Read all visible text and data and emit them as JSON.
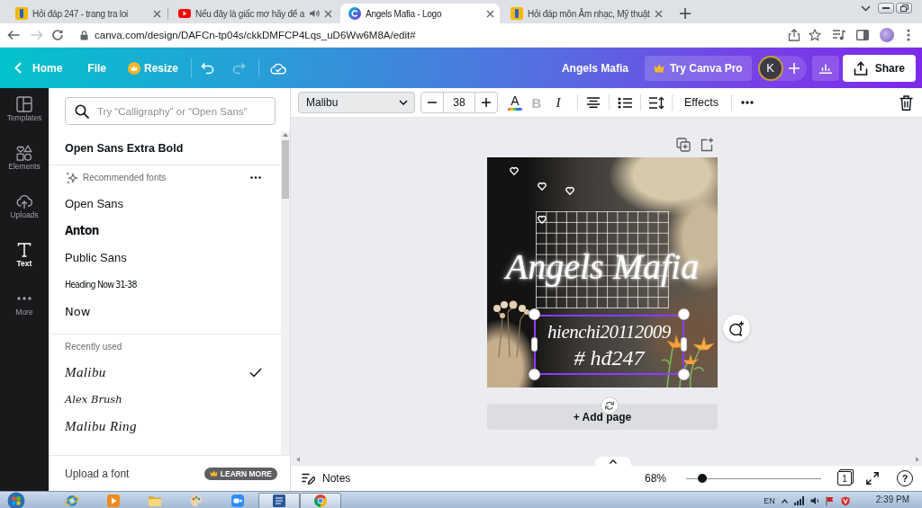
{
  "browser": {
    "tabs": [
      {
        "kind": "hoidap",
        "title": "Hỏi đáp 247 - trang tra loi",
        "audio": false,
        "selected": false
      },
      {
        "kind": "youtube",
        "title": "Nếu đây là giấc mơ hãy để a",
        "audio": true,
        "selected": false
      },
      {
        "kind": "canva",
        "title": "Angels Mafia - Logo",
        "audio": false,
        "selected": true
      },
      {
        "kind": "hoidap",
        "title": "Hỏi đáp môn Âm nhạc, Mỹ thuật",
        "audio": false,
        "selected": false
      }
    ],
    "nav": [
      {
        "kind": "back",
        "disabled": false
      },
      {
        "kind": "forward",
        "disabled": true
      }
    ],
    "url": "canva.com/design/DAFCn-tp04s/ckkDMFCP4Lqs_uD6Ww6M8A/edit#"
  },
  "header": {
    "home": "Home",
    "file": "File",
    "resize": "Resize",
    "history": [
      {
        "kind": "undo",
        "disabled": false
      },
      {
        "kind": "redo",
        "disabled": true
      }
    ],
    "design_title": "Angels Mafia",
    "pro_button": "Try Canva Pro",
    "avatar": "K",
    "share": "Share"
  },
  "sidebar": {
    "items": [
      {
        "kind": "templates",
        "label": "Templates",
        "selected": false
      },
      {
        "kind": "elements",
        "label": "Elements",
        "selected": false
      },
      {
        "kind": "uploads",
        "label": "Uploads",
        "selected": false
      },
      {
        "kind": "text",
        "label": "Text",
        "selected": true
      },
      {
        "kind": "more",
        "label": "More",
        "selected": false
      }
    ]
  },
  "font_panel": {
    "search": {
      "placeholder": "Try “Calligraphy” or “Open Sans”"
    },
    "current_font": "Open Sans Extra Bold",
    "sections": [
      {
        "kind": "recommended",
        "title": "Recommended fonts",
        "fonts": [
          {
            "name": "Open Sans",
            "kind": "sans",
            "selected": false
          },
          {
            "name": "Anton",
            "kind": "heavy",
            "selected": false
          },
          {
            "name": "Public Sans",
            "kind": "sans",
            "selected": false
          },
          {
            "name": "Heading Now 31-38",
            "kind": "narrow",
            "selected": false
          },
          {
            "name": "Now",
            "kind": "geometric",
            "selected": false
          }
        ]
      },
      {
        "kind": "recent",
        "title": "Recently used",
        "fonts": [
          {
            "name": "Malibu",
            "kind": "script",
            "selected": true
          },
          {
            "name": "Alex Brush",
            "kind": "brush",
            "selected": false
          },
          {
            "name": "Malibu Ring",
            "kind": "script",
            "selected": false
          }
        ]
      }
    ],
    "upload": "Upload a font",
    "badge": "LEARN MORE"
  },
  "toolbar": {
    "font": "Malibu",
    "size": "38",
    "tools": [
      {
        "kind": "color",
        "label": "A",
        "disabled": false
      },
      {
        "kind": "bold",
        "label": "B",
        "disabled": true
      },
      {
        "kind": "italic",
        "label": "I",
        "disabled": false
      },
      {
        "kind": "align",
        "disabled": false
      },
      {
        "kind": "list",
        "disabled": false
      },
      {
        "kind": "spacing",
        "disabled": false
      }
    ],
    "effects": "Effects"
  },
  "design": {
    "title": "Angels Mafia",
    "caption": [
      "hienchi20112009",
      "# hđ247"
    ],
    "selected": true,
    "add_page": "+ Add page"
  },
  "bottom_bar": {
    "notes": "Notes",
    "zoom": {
      "reading": "68%",
      "level": 0.12
    },
    "page_count": "1",
    "help": "?"
  },
  "taskbar": {
    "apps": [
      {
        "kind": "ie",
        "open": false
      },
      {
        "kind": "media",
        "open": false
      },
      {
        "kind": "folder",
        "open": false
      },
      {
        "kind": "paint",
        "open": false
      },
      {
        "kind": "zoom",
        "open": false
      },
      {
        "kind": "word",
        "open": true
      },
      {
        "kind": "chrome",
        "open": true
      }
    ],
    "language": "EN",
    "time": "2:39 PM"
  }
}
